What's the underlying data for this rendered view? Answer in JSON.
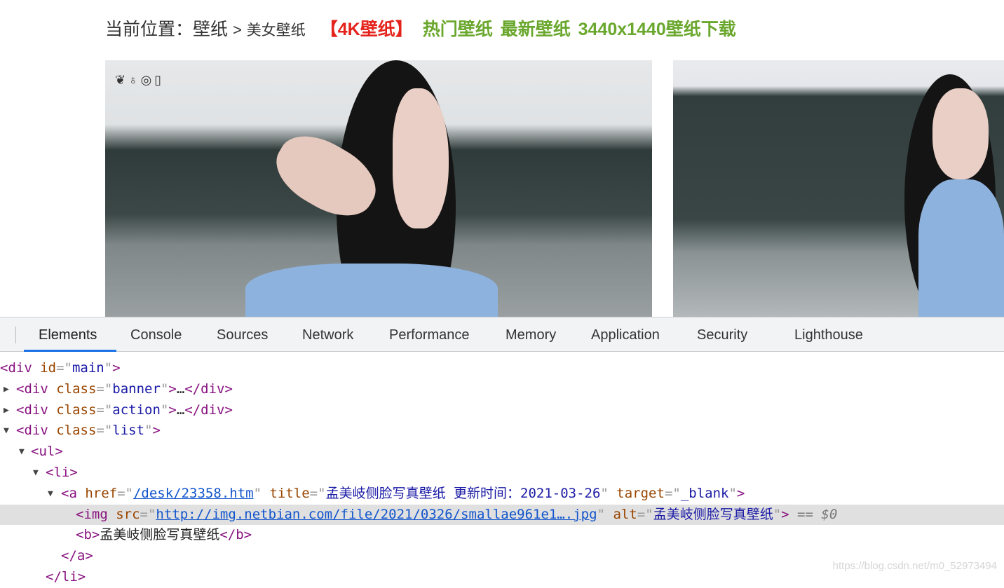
{
  "breadcrumb": {
    "label": "当前位置：",
    "root": "壁纸",
    "sep": ">",
    "category": "美女壁纸",
    "highlight": "【4K壁纸】",
    "links": [
      "热门壁纸",
      "最新壁纸",
      "3440x1440壁纸下载"
    ]
  },
  "gallery": {
    "logo_text": "少女"
  },
  "devtools": {
    "tabs": [
      "Elements",
      "Console",
      "Sources",
      "Network",
      "Performance",
      "Memory",
      "Application",
      "Security",
      "Lighthouse"
    ],
    "active_tab": "Elements",
    "lines": [
      {
        "indent": 0,
        "tri": "",
        "sel": false,
        "tokens": [
          [
            "tg",
            "<div "
          ],
          [
            "an",
            "id"
          ],
          [
            "pn",
            "=\""
          ],
          [
            "av",
            "main"
          ],
          [
            "pn",
            "\""
          ],
          [
            "tg",
            ">"
          ]
        ]
      },
      {
        "indent": 1,
        "tri": "right",
        "sel": false,
        "tokens": [
          [
            "tg",
            "<div "
          ],
          [
            "an",
            "class"
          ],
          [
            "pn",
            "=\""
          ],
          [
            "av",
            "banner"
          ],
          [
            "pn",
            "\""
          ],
          [
            "tg",
            ">"
          ],
          [
            "tx",
            "…"
          ],
          [
            "tg",
            "</div>"
          ]
        ]
      },
      {
        "indent": 1,
        "tri": "right",
        "sel": false,
        "tokens": [
          [
            "tg",
            "<div "
          ],
          [
            "an",
            "class"
          ],
          [
            "pn",
            "=\""
          ],
          [
            "av",
            "action"
          ],
          [
            "pn",
            "\""
          ],
          [
            "tg",
            ">"
          ],
          [
            "tx",
            "…"
          ],
          [
            "tg",
            "</div>"
          ]
        ]
      },
      {
        "indent": 1,
        "tri": "down",
        "sel": false,
        "tokens": [
          [
            "tg",
            "<div "
          ],
          [
            "an",
            "class"
          ],
          [
            "pn",
            "=\""
          ],
          [
            "av",
            "list"
          ],
          [
            "pn",
            "\""
          ],
          [
            "tg",
            ">"
          ]
        ]
      },
      {
        "indent": 2,
        "tri": "down",
        "sel": false,
        "tokens": [
          [
            "tg",
            "<ul>"
          ]
        ]
      },
      {
        "indent": 3,
        "tri": "down",
        "sel": false,
        "tokens": [
          [
            "tg",
            "<li>"
          ]
        ]
      },
      {
        "indent": 4,
        "tri": "down",
        "sel": false,
        "tokens": [
          [
            "tg",
            "<a "
          ],
          [
            "an",
            "href"
          ],
          [
            "pn",
            "=\""
          ],
          [
            "lk",
            "/desk/23358.htm"
          ],
          [
            "pn",
            "\" "
          ],
          [
            "an",
            "title"
          ],
          [
            "pn",
            "=\""
          ],
          [
            "av",
            "孟美岐侧脸写真壁纸 更新时间：2021-03-26"
          ],
          [
            "pn",
            "\" "
          ],
          [
            "an",
            "target"
          ],
          [
            "pn",
            "=\""
          ],
          [
            "av",
            "_blank"
          ],
          [
            "pn",
            "\""
          ],
          [
            "tg",
            ">"
          ]
        ]
      },
      {
        "indent": 5,
        "tri": "",
        "sel": true,
        "tokens": [
          [
            "tg",
            "<img "
          ],
          [
            "an",
            "src"
          ],
          [
            "pn",
            "=\""
          ],
          [
            "lk",
            "http://img.netbian.com/file/2021/0326/smallae961e1….jpg"
          ],
          [
            "pn",
            "\" "
          ],
          [
            "an",
            "alt"
          ],
          [
            "pn",
            "=\""
          ],
          [
            "av",
            "孟美岐侧脸写真壁纸"
          ],
          [
            "pn",
            "\""
          ],
          [
            "tg",
            ">"
          ],
          [
            "eq",
            " == "
          ],
          [
            "dl",
            "$0"
          ]
        ]
      },
      {
        "indent": 5,
        "tri": "",
        "sel": false,
        "tokens": [
          [
            "tg",
            "<b>"
          ],
          [
            "tx",
            "孟美岐侧脸写真壁纸"
          ],
          [
            "tg",
            "</b>"
          ]
        ]
      },
      {
        "indent": 4,
        "tri": "",
        "sel": false,
        "tokens": [
          [
            "tg",
            "</a>"
          ]
        ]
      },
      {
        "indent": 3,
        "tri": "",
        "sel": false,
        "tokens": [
          [
            "tg",
            "</li>"
          ]
        ]
      }
    ]
  },
  "watermark": "https://blog.csdn.net/m0_52973494"
}
